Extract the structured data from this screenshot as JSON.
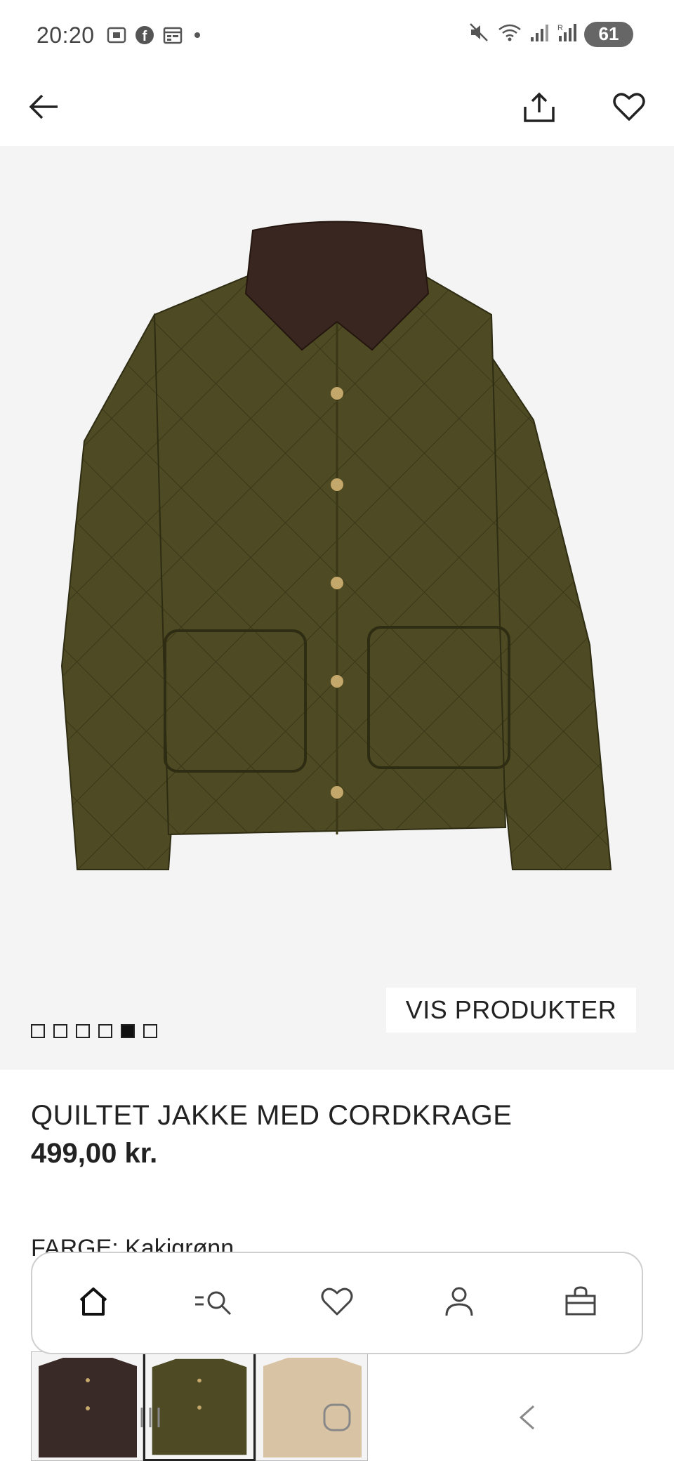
{
  "status_bar": {
    "time": "20:20",
    "battery": "61",
    "icons_left": [
      "screenshot-icon",
      "facebook-icon",
      "calendar-icon"
    ],
    "icons_right": [
      "mute-icon",
      "wifi-icon",
      "signal-icon",
      "signal-r-icon",
      "battery-icon"
    ]
  },
  "header": {
    "back_icon": "arrow-left-icon",
    "share_icon": "share-icon",
    "favorite_icon": "heart-icon"
  },
  "gallery": {
    "image_alt": "jacket-image",
    "image_count": 6,
    "active_index": 4,
    "show_products_label": "VIS PRODUKTER"
  },
  "product": {
    "title": "QUILTET JAKKE MED CORDKRAGE",
    "price": "499,00 kr.",
    "color_label": "FARGE: Kakigrønn"
  },
  "swatches": [
    {
      "color": "#3a2a27",
      "selected": false
    },
    {
      "color": "#4e4a24",
      "selected": true
    },
    {
      "color": "#d8c3a4",
      "selected": false
    }
  ],
  "bottom_nav": [
    {
      "name": "home",
      "icon": "home-icon",
      "active": true
    },
    {
      "name": "search",
      "icon": "search-icon",
      "active": false
    },
    {
      "name": "favorites",
      "icon": "heart-icon",
      "active": false
    },
    {
      "name": "account",
      "icon": "user-icon",
      "active": false
    },
    {
      "name": "bag",
      "icon": "shopping-bag-icon",
      "active": false
    }
  ],
  "colors": {
    "jacket": "#4e4a24",
    "collar": "#3a2620",
    "background": "#f4f4f4"
  }
}
